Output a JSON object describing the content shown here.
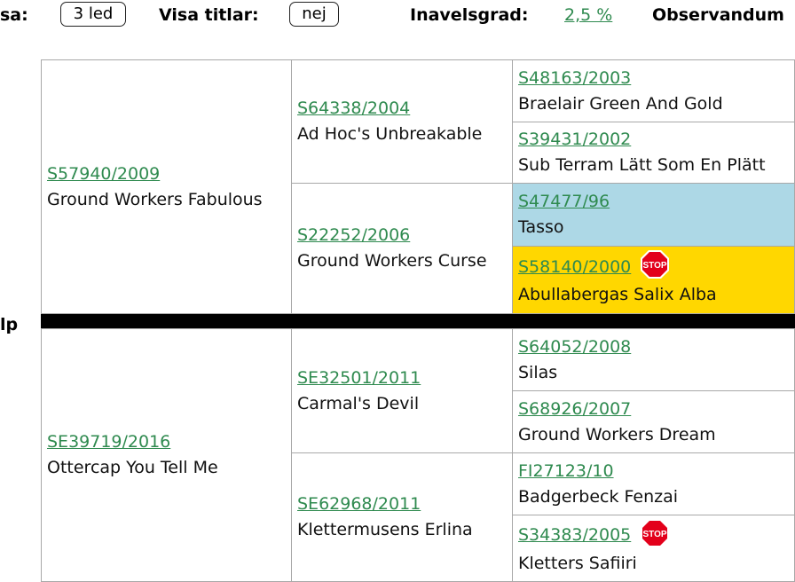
{
  "toolbar": {
    "visa_label": "sa:",
    "visa_value": "3 led",
    "titles_label": "Visa titlar:",
    "titles_value": "nej",
    "inbreeding_label": "Inavelsgrad:",
    "inbreeding_value": "2,5 %",
    "observandum_label": "Observandum"
  },
  "side_label": "lp",
  "pedigree": {
    "sire": {
      "reg": "S57940/2009",
      "name": "Ground Workers Fabulous"
    },
    "sire_sire": {
      "reg": "S64338/2004",
      "name": "Ad Hoc's Unbreakable"
    },
    "sire_dam": {
      "reg": "S22252/2006",
      "name": "Ground Workers Curse"
    },
    "ss_sire": {
      "reg": "S48163/2003",
      "name": "Braelair Green And Gold"
    },
    "ss_dam": {
      "reg": "S39431/2002",
      "name": "Sub Terram Lätt Som En Plätt"
    },
    "sd_sire": {
      "reg": "S47477/96",
      "name": "Tasso"
    },
    "sd_dam": {
      "reg": "S58140/2000",
      "name": "Abullabergas Salix Alba",
      "stop": "STOP"
    },
    "dam": {
      "reg": "SE39719/2016",
      "name": "Ottercap You Tell Me"
    },
    "dam_sire": {
      "reg": "SE32501/2011",
      "name": "Carmal's Devil"
    },
    "dam_dam": {
      "reg": "SE62968/2011",
      "name": "Klettermusens Erlina"
    },
    "ds_sire": {
      "reg": "S64052/2008",
      "name": "Silas"
    },
    "ds_dam": {
      "reg": "S68926/2007",
      "name": "Ground Workers Dream"
    },
    "dd_sire": {
      "reg": "FI27123/10",
      "name": "Badgerbeck Fenzai"
    },
    "dd_dam": {
      "reg": "S34383/2005",
      "name": "Kletters Safiiri",
      "stop": "STOP"
    }
  },
  "colors": {
    "link": "#2f8a4f",
    "highlight_blue": "#add8e6",
    "highlight_yellow": "#ffd700",
    "stop_red": "#e3001b"
  },
  "icons": {
    "stop": "stop-sign-icon"
  }
}
